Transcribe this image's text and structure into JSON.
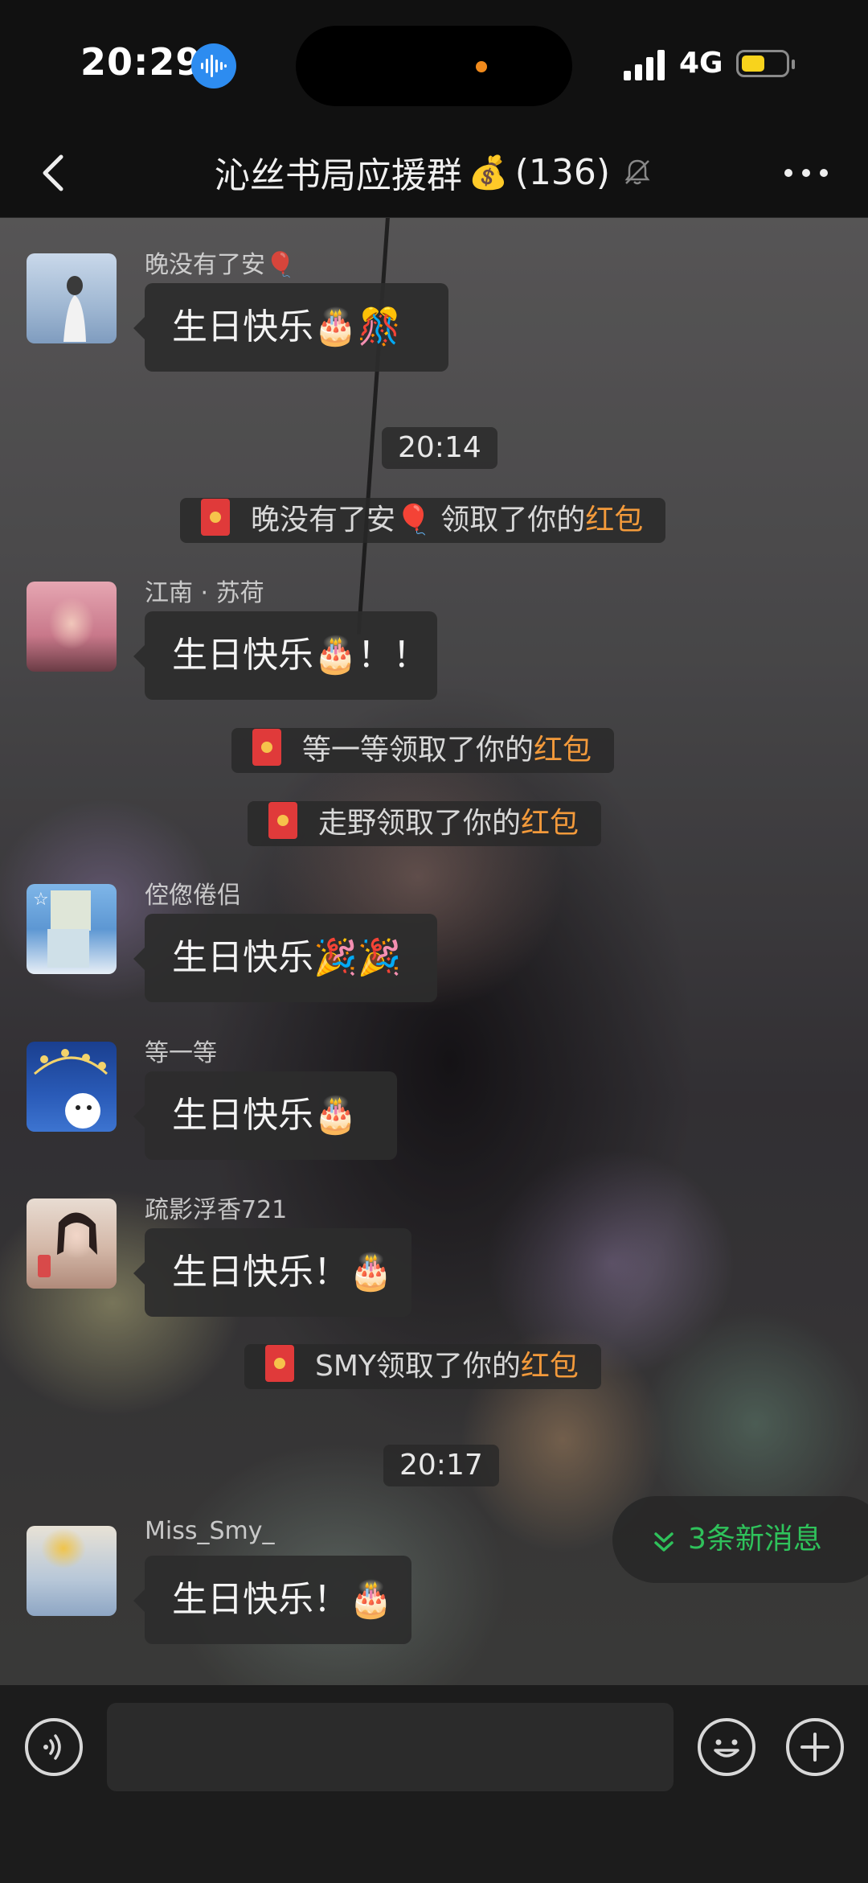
{
  "status_bar": {
    "time": "20:29",
    "network": "4G"
  },
  "header": {
    "title": "沁丝书局应援群",
    "member_count": "(136)"
  },
  "messages": [
    {
      "sender": "晚没有了安🎈",
      "text": "生日快乐",
      "emoji": "🎂🎊"
    },
    {
      "sender": "江南 · 苏荷",
      "text": "生日快乐",
      "emoji": "🎂！！"
    },
    {
      "sender": "倥偬倦侣",
      "text": "生日快乐",
      "emoji": "🎉🎉"
    },
    {
      "sender": "等一等",
      "text": "生日快乐",
      "emoji": "🎂"
    },
    {
      "sender": "疏影浮香721",
      "text": "生日快乐！",
      "emoji": "🎂"
    },
    {
      "sender": "Miss_Smy_",
      "text": "生日快乐！",
      "emoji": "🎂"
    }
  ],
  "timestamps": [
    "20:14",
    "20:17"
  ],
  "notices": [
    {
      "who": "晚没有了安🎈",
      "action": " 领取了你的",
      "highlight": "红包"
    },
    {
      "who": "等一等",
      "action": "领取了你的",
      "highlight": "红包"
    },
    {
      "who": "走野",
      "action": "领取了你的",
      "highlight": "红包"
    },
    {
      "who": "SMY",
      "action": "领取了你的",
      "highlight": "红包"
    }
  ],
  "new_messages_button": "3条新消息",
  "colors": {
    "accent_green": "#2fc25b",
    "hongbao_orange": "#f39a3b",
    "redpacket_red": "#e03a3a"
  },
  "icons": [
    "back-icon",
    "moneybag-icon",
    "mute-bell-icon",
    "more-icon",
    "voice-input-icon",
    "emoji-icon",
    "plus-icon",
    "redpacket-icon"
  ]
}
